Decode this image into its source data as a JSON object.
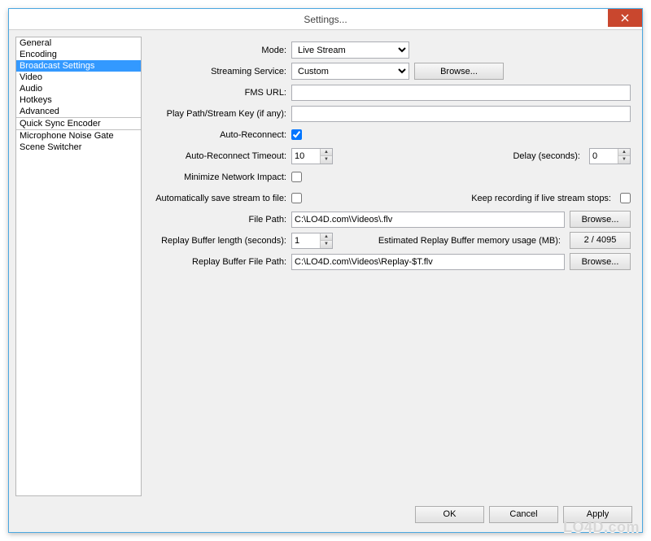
{
  "window_title": "Settings...",
  "sidebar": {
    "items": [
      {
        "label": "General"
      },
      {
        "label": "Encoding"
      },
      {
        "label": "Broadcast Settings",
        "selected": true
      },
      {
        "label": "Video"
      },
      {
        "label": "Audio"
      },
      {
        "label": "Hotkeys"
      },
      {
        "label": "Advanced"
      },
      {
        "label": "Quick Sync Encoder",
        "separator_before": true
      },
      {
        "label": "Microphone Noise Gate",
        "separator_before": true
      },
      {
        "label": "Scene Switcher"
      }
    ]
  },
  "form": {
    "mode_label": "Mode:",
    "mode_value": "Live Stream",
    "service_label": "Streaming Service:",
    "service_value": "Custom",
    "browse_label": "Browse...",
    "fms_label": "FMS URL:",
    "fms_value": "",
    "playpath_label": "Play Path/Stream Key (if any):",
    "playpath_value": "",
    "autoreconnect_label": "Auto-Reconnect:",
    "autoreconnect_checked": true,
    "timeout_label": "Auto-Reconnect Timeout:",
    "timeout_value": "10",
    "delay_label": "Delay (seconds):",
    "delay_value": "0",
    "minnet_label": "Minimize Network Impact:",
    "minnet_checked": false,
    "autosave_label": "Automatically save stream to file:",
    "autosave_checked": false,
    "keeprec_label": "Keep recording if live stream stops:",
    "keeprec_checked": false,
    "filepath_label": "File Path:",
    "filepath_value": "C:\\LO4D.com\\Videos\\.flv",
    "replaylen_label": "Replay Buffer length (seconds):",
    "replaylen_value": "1",
    "memusage_label": "Estimated Replay Buffer memory usage (MB):",
    "memusage_value": "2 / 4095",
    "replaypath_label": "Replay Buffer File Path:",
    "replaypath_value": "C:\\LO4D.com\\Videos\\Replay-$T.flv"
  },
  "buttons": {
    "ok": "OK",
    "cancel": "Cancel",
    "apply": "Apply"
  },
  "watermark": "LO4D.com"
}
